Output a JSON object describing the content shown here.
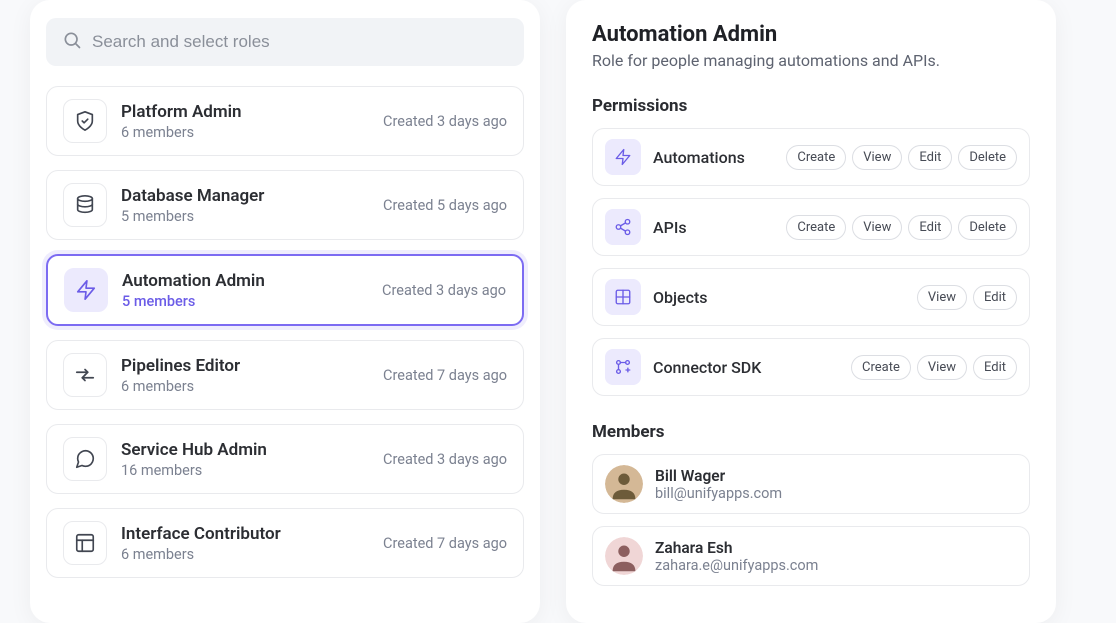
{
  "search": {
    "placeholder": "Search and select roles"
  },
  "roles": [
    {
      "name": "Platform Admin",
      "members": "6 members",
      "created": "Created 3 days ago",
      "icon": "shield",
      "selected": false
    },
    {
      "name": "Database Manager",
      "members": "5 members",
      "created": "Created 5 days ago",
      "icon": "database",
      "selected": false
    },
    {
      "name": "Automation Admin",
      "members": "5 members",
      "created": "Created 3 days ago",
      "icon": "lightning",
      "selected": true
    },
    {
      "name": "Pipelines Editor",
      "members": "6 members",
      "created": "Created 7 days ago",
      "icon": "arrows",
      "selected": false
    },
    {
      "name": "Service Hub Admin",
      "members": "16 members",
      "created": "Created 3 days ago",
      "icon": "chat",
      "selected": false
    },
    {
      "name": "Interface Contributor",
      "members": "6 members",
      "created": "Created 7 days ago",
      "icon": "layout",
      "selected": false
    }
  ],
  "detail": {
    "title": "Automation Admin",
    "description": "Role for people managing automations and APIs.",
    "permissions_label": "Permissions",
    "permissions": [
      {
        "name": "Automations",
        "icon": "lightning",
        "actions": [
          "Create",
          "View",
          "Edit",
          "Delete"
        ]
      },
      {
        "name": "APIs",
        "icon": "share",
        "actions": [
          "Create",
          "View",
          "Edit",
          "Delete"
        ]
      },
      {
        "name": "Objects",
        "icon": "grid",
        "actions": [
          "View",
          "Edit"
        ]
      },
      {
        "name": "Connector SDK",
        "icon": "connector",
        "actions": [
          "Create",
          "View",
          "Edit"
        ]
      }
    ],
    "members_label": "Members",
    "members": [
      {
        "name": "Bill Wager",
        "email": "bill@unifyapps.com",
        "avatar_bg": "#d4b896",
        "avatar_fg": "#5a4a2a"
      },
      {
        "name": "Zahara Esh",
        "email": "zahara.e@unifyapps.com",
        "avatar_bg": "#f0d6d6",
        "avatar_fg": "#7a4a4a"
      }
    ]
  },
  "icons": {
    "shield": "shield",
    "database": "database",
    "lightning": "lightning",
    "arrows": "arrows",
    "chat": "chat",
    "layout": "layout",
    "share": "share",
    "grid": "grid",
    "connector": "connector"
  }
}
